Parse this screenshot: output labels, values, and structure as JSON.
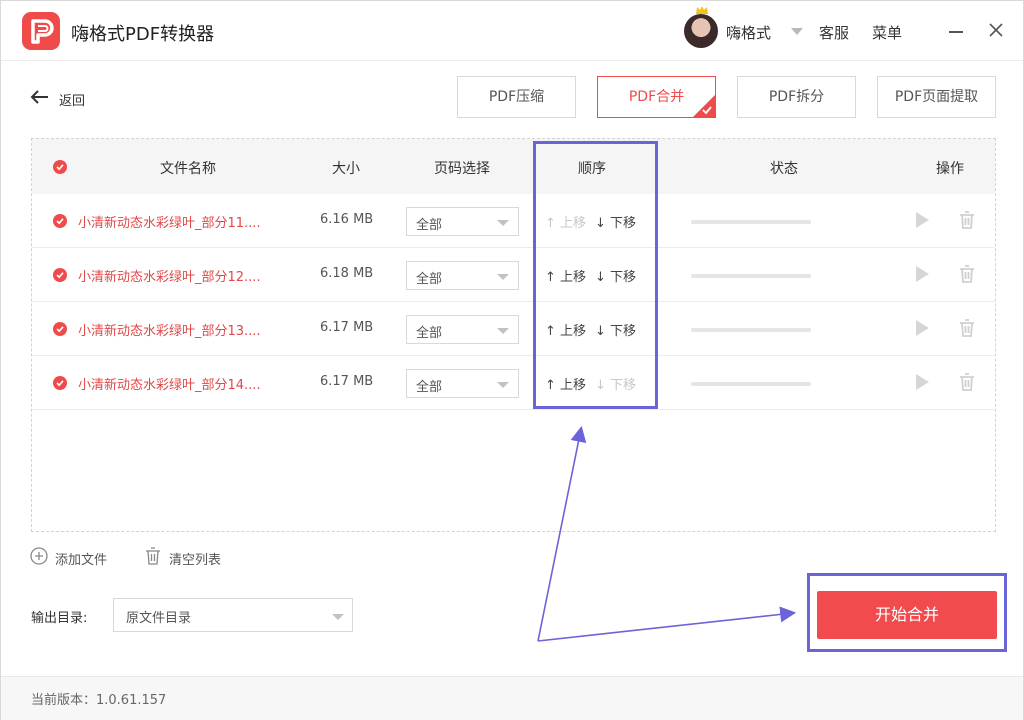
{
  "app": {
    "title": "嗨格式PDF转换器",
    "brand_color": "#f04b4b"
  },
  "header": {
    "username": "嗨格式",
    "service": "客服",
    "menu": "菜单"
  },
  "nav": {
    "back_label": "返回"
  },
  "tabs": [
    {
      "label": "PDF压缩",
      "active": false
    },
    {
      "label": "PDF合并",
      "active": true
    },
    {
      "label": "PDF拆分",
      "active": false
    },
    {
      "label": "PDF页面提取",
      "active": false
    }
  ],
  "table": {
    "columns": {
      "name": "文件名称",
      "size": "大小",
      "pages": "页码选择",
      "order": "顺序",
      "status": "状态",
      "actions": "操作"
    },
    "rows": [
      {
        "name": "小清新动态水彩绿叶_部分11....",
        "size": "6.16 MB",
        "pages": "全部",
        "up": "上移",
        "down": "下移",
        "up_enabled": false,
        "down_enabled": true
      },
      {
        "name": "小清新动态水彩绿叶_部分12....",
        "size": "6.18 MB",
        "pages": "全部",
        "up": "上移",
        "down": "下移",
        "up_enabled": true,
        "down_enabled": true
      },
      {
        "name": "小清新动态水彩绿叶_部分13....",
        "size": "6.17 MB",
        "pages": "全部",
        "up": "上移",
        "down": "下移",
        "up_enabled": true,
        "down_enabled": true
      },
      {
        "name": "小清新动态水彩绿叶_部分14....",
        "size": "6.17 MB",
        "pages": "全部",
        "up": "上移",
        "down": "下移",
        "up_enabled": true,
        "down_enabled": false
      }
    ]
  },
  "controls": {
    "add_file": "添加文件",
    "clear_list": "清空列表"
  },
  "output": {
    "label": "输出目录:",
    "value": "原文件目录"
  },
  "start_button": "开始合并",
  "footer": {
    "version": "当前版本：1.0.61.157"
  },
  "annotation_color": "#6b64d9"
}
